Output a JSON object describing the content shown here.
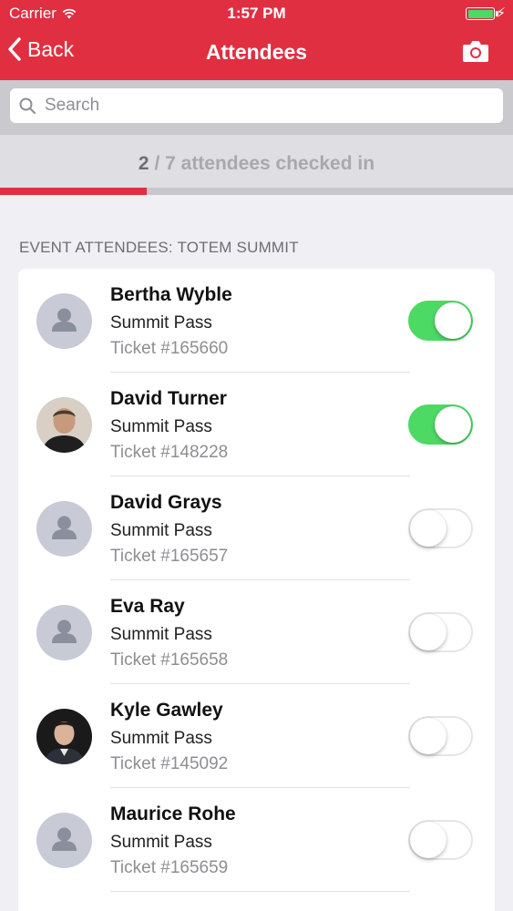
{
  "status_bar": {
    "carrier": "Carrier",
    "time": "1:57 PM",
    "battery_color": "#4cd964"
  },
  "nav": {
    "back_label": "Back",
    "title": "Attendees",
    "brand_color": "#e02f41",
    "right_icon": "camera-icon"
  },
  "search": {
    "placeholder": "Search",
    "value": ""
  },
  "checkin": {
    "checked": "2",
    "separator": " / ",
    "text": "7 attendees checked in",
    "progress_fraction": 0.2857
  },
  "section": {
    "header": "EVENT ATTENDEES: TOTEM SUMMIT"
  },
  "attendees": [
    {
      "name": "Bertha Wyble",
      "pass": "Summit Pass",
      "ticket": "Ticket #165660",
      "checked_in": true,
      "avatar": "placeholder"
    },
    {
      "name": "David Turner",
      "pass": "Summit Pass",
      "ticket": "Ticket #148228",
      "checked_in": true,
      "avatar": "photo"
    },
    {
      "name": "David Grays",
      "pass": "Summit Pass",
      "ticket": "Ticket #165657",
      "checked_in": false,
      "avatar": "placeholder"
    },
    {
      "name": "Eva Ray",
      "pass": "Summit Pass",
      "ticket": "Ticket #165658",
      "checked_in": false,
      "avatar": "placeholder"
    },
    {
      "name": "Kyle Gawley",
      "pass": "Summit Pass",
      "ticket": "Ticket #145092",
      "checked_in": false,
      "avatar": "photo"
    },
    {
      "name": "Maurice Rohe",
      "pass": "Summit Pass",
      "ticket": "Ticket #165659",
      "checked_in": false,
      "avatar": "placeholder"
    }
  ]
}
